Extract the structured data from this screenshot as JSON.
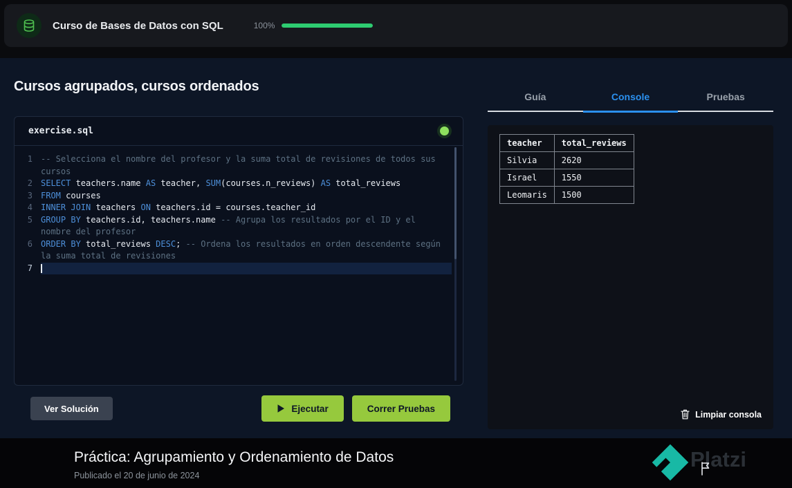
{
  "header": {
    "course_title": "Curso de Bases de Datos con SQL",
    "progress_label": "100%",
    "progress_percent": 100
  },
  "exercise": {
    "title": "Cursos agrupados, cursos ordenados",
    "file_name": "exercise.sql",
    "buttons": {
      "solution": "Ver Solución",
      "run": "Ejecutar",
      "tests": "Correr Pruebas"
    },
    "code_lines": [
      {
        "num": "1",
        "tokens": [
          {
            "c": "comment",
            "t": "-- Selecciona el nombre del profesor y la suma total de revisiones de todos sus cursos"
          }
        ]
      },
      {
        "num": "2",
        "tokens": [
          {
            "c": "kw",
            "t": "SELECT"
          },
          {
            "c": "plain",
            "t": " teachers.name "
          },
          {
            "c": "kw",
            "t": "AS"
          },
          {
            "c": "plain",
            "t": " teacher, "
          },
          {
            "c": "kw",
            "t": "SUM"
          },
          {
            "c": "plain",
            "t": "(courses.n_reviews) "
          },
          {
            "c": "kw",
            "t": "AS"
          },
          {
            "c": "plain",
            "t": " total_reviews"
          }
        ]
      },
      {
        "num": "3",
        "tokens": [
          {
            "c": "kw",
            "t": "FROM"
          },
          {
            "c": "plain",
            "t": " courses"
          }
        ]
      },
      {
        "num": "4",
        "tokens": [
          {
            "c": "kw",
            "t": "INNER JOIN"
          },
          {
            "c": "plain",
            "t": " teachers "
          },
          {
            "c": "kw",
            "t": "ON"
          },
          {
            "c": "plain",
            "t": " teachers.id = courses.teacher_id"
          }
        ]
      },
      {
        "num": "5",
        "tokens": [
          {
            "c": "kw",
            "t": "GROUP BY"
          },
          {
            "c": "plain",
            "t": " teachers.id, teachers.name "
          },
          {
            "c": "comment",
            "t": "-- Agrupa los resultados por el ID y el nombre del profesor"
          }
        ]
      },
      {
        "num": "6",
        "tokens": [
          {
            "c": "kw",
            "t": "ORDER BY"
          },
          {
            "c": "plain",
            "t": " total_reviews "
          },
          {
            "c": "kw",
            "t": "DESC"
          },
          {
            "c": "plain",
            "t": "; "
          },
          {
            "c": "comment",
            "t": "-- Ordena los resultados en orden descendente según la suma total de revisiones"
          }
        ]
      },
      {
        "num": "7",
        "tokens": [],
        "active": true,
        "cursor": true
      }
    ]
  },
  "panel": {
    "tabs": [
      {
        "label": "Guía",
        "active": false
      },
      {
        "label": "Console",
        "active": true
      },
      {
        "label": "Pruebas",
        "active": false
      }
    ],
    "console_table": {
      "headers": [
        "teacher",
        "total_reviews"
      ],
      "rows": [
        [
          "Silvia",
          "2620"
        ],
        [
          "Israel",
          "1550"
        ],
        [
          "Leomaris",
          "1500"
        ]
      ]
    },
    "clear_label": "Limpiar consola"
  },
  "footer": {
    "title": "Práctica: Agrupamiento y Ordenamiento de Datos",
    "published": "Publicado el 20 de junio de 2024",
    "brand": "Platzi"
  },
  "colors": {
    "accent_green": "#96c93d",
    "progress_green": "#2ecc71",
    "tab_active_blue": "#2b90ef",
    "keyword_blue": "#4d8fd9",
    "comment_gray": "#5d7183",
    "brand_teal": "#18b9a5",
    "status_dot_green": "#8ee05e"
  }
}
